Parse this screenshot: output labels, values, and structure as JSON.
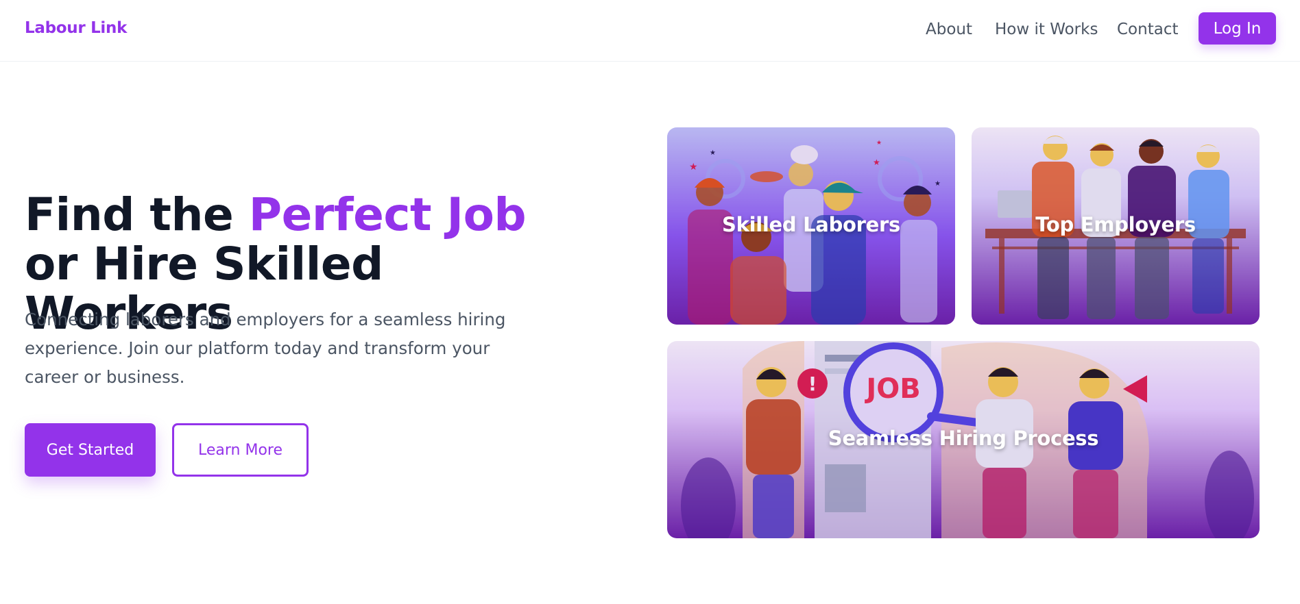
{
  "nav": {
    "brand": "Labour Link",
    "links": [
      "About",
      "How it Works",
      "Contact"
    ],
    "login_label": "Log In"
  },
  "hero": {
    "title_part1": "Find the ",
    "title_accent": "Perfect Job",
    "title_part2": " or Hire Skilled Workers",
    "description": "Connecting laborers and employers for a seamless hiring experience. Join our platform today and transform your career or business.",
    "primary_cta": "Get Started",
    "secondary_cta": "Learn More"
  },
  "cards": [
    {
      "label": "Skilled Laborers"
    },
    {
      "label": "Top Employers"
    },
    {
      "label": "Seamless Hiring Process",
      "art_text": "JOB"
    }
  ],
  "colors": {
    "accent": "#9333ea",
    "heading": "#111827",
    "body_text": "#4b5563",
    "card_gradient_top": "#c7d2fe",
    "card_gradient_bottom": "#6b21a8"
  }
}
